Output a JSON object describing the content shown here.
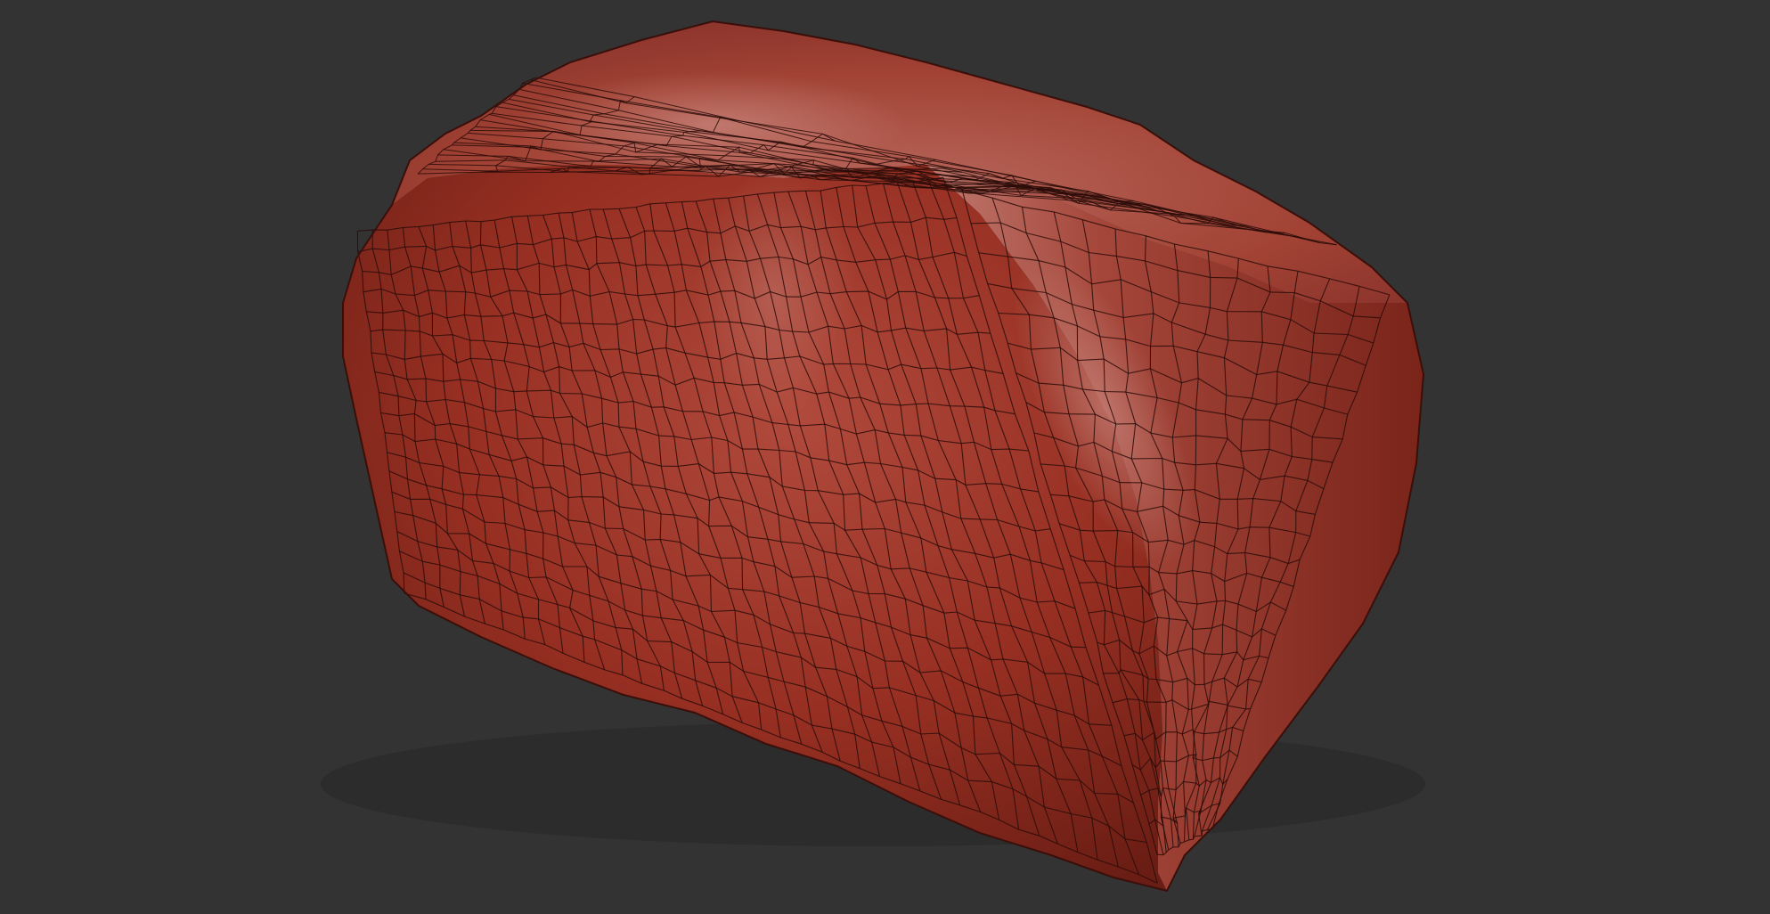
{
  "viewport": {
    "background": "#333333"
  },
  "model": {
    "shape": "lumpy-box-mesh",
    "material_color": "#a43a2c",
    "material_highlight": "#c68a80",
    "material_shadow": "#5e1a12",
    "wire_color": "#2a0c08",
    "wireframe": true,
    "grid_columns": 38,
    "grid_rows": 18
  }
}
